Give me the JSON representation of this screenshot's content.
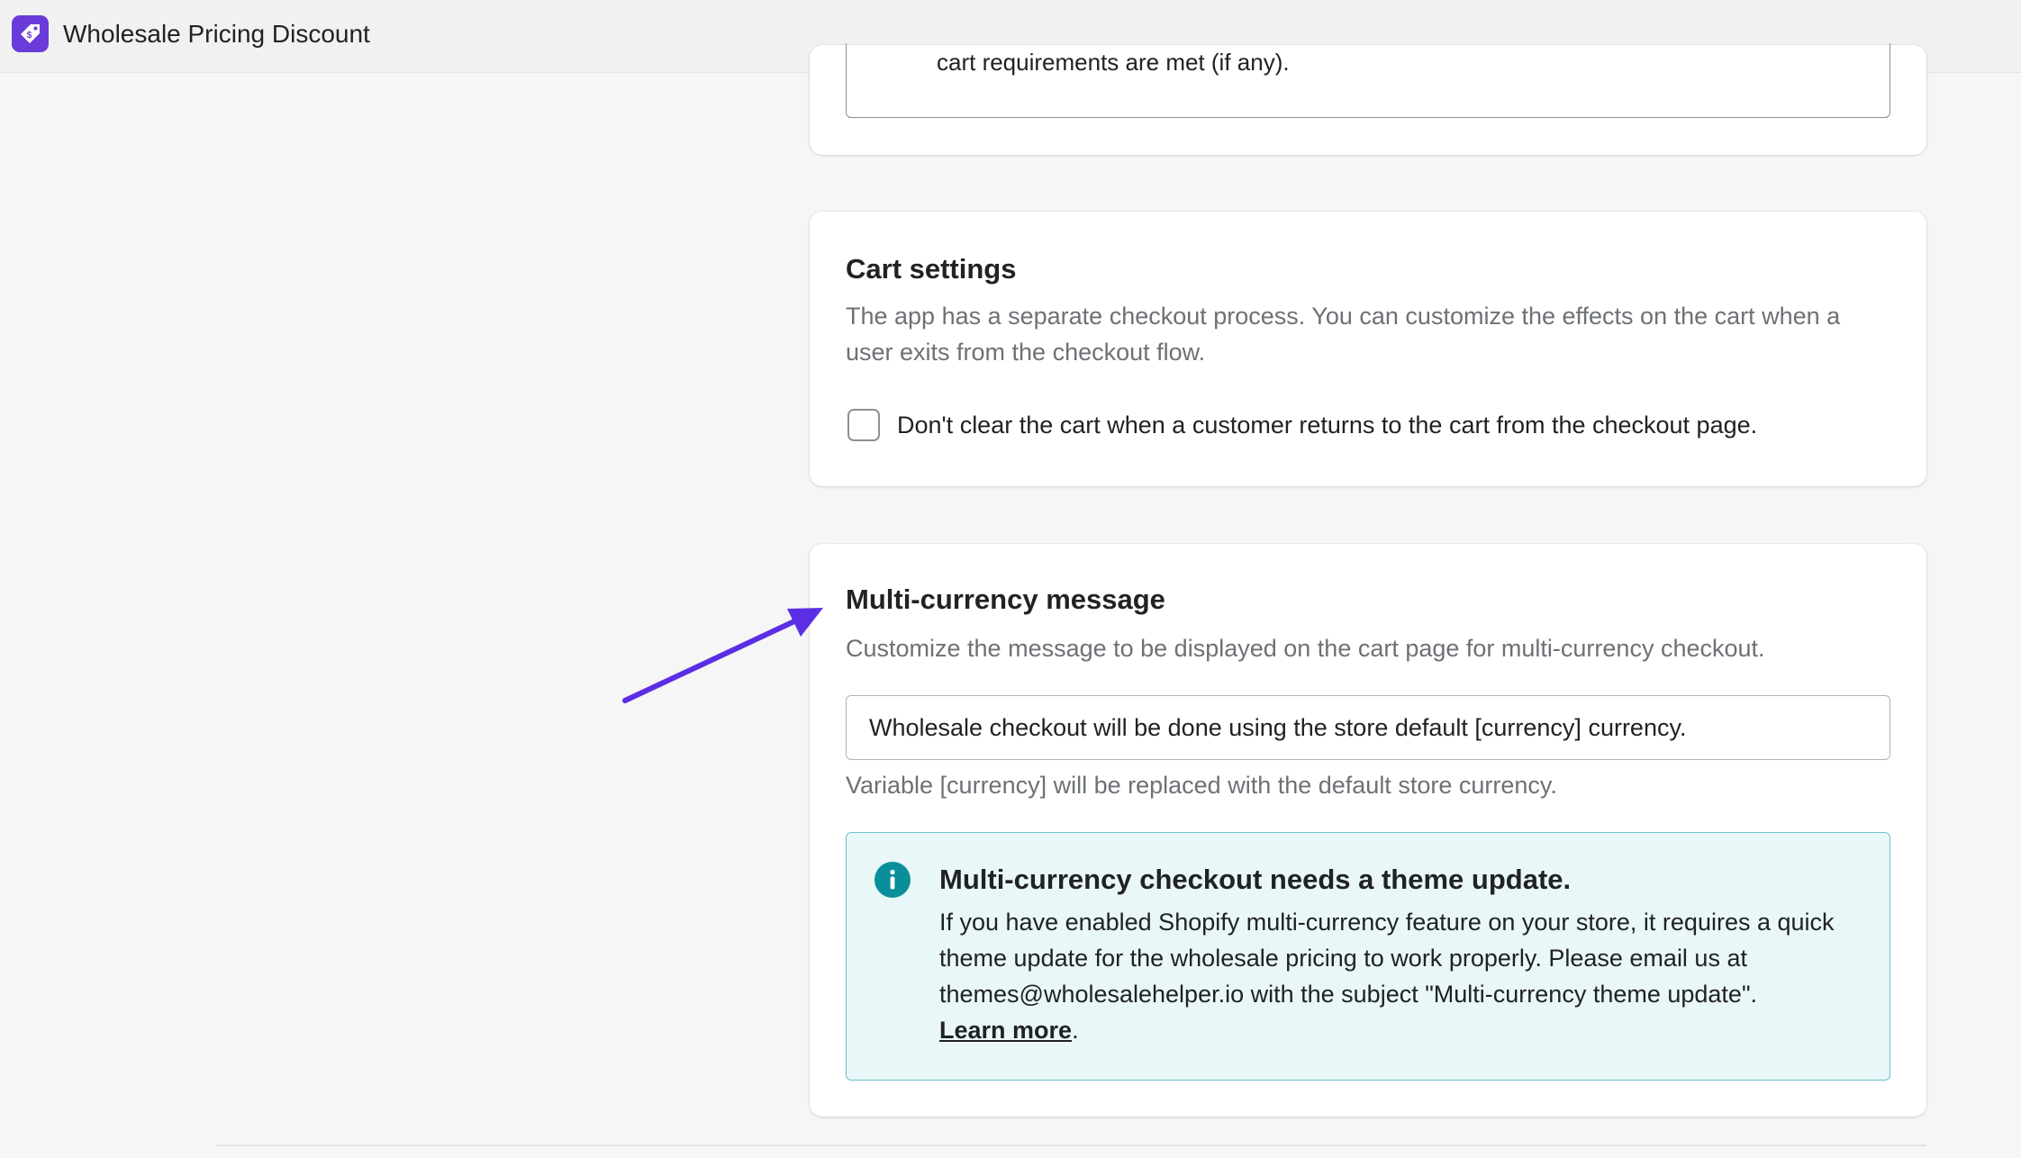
{
  "app": {
    "title": "Wholesale Pricing Discount",
    "icon": "price-tag-icon",
    "accent_color": "#6a3bd8"
  },
  "previous_card": {
    "partial_text": "cart requirements are met (if any)."
  },
  "cart_settings": {
    "title": "Cart settings",
    "description": "The app has a separate checkout process. You can customize the effects on the cart when a user exits from the checkout flow.",
    "checkbox_label": "Don't clear the cart when a customer returns to the cart from the checkout page.",
    "checkbox_checked": false
  },
  "multi_currency": {
    "title": "Multi-currency message",
    "description": "Customize the message to be displayed on the cart page for multi-currency checkout.",
    "input_value": "Wholesale checkout will be done using the store default [currency] currency.",
    "help_text": "Variable [currency] will be replaced with the default store currency.",
    "banner": {
      "icon": "info-icon",
      "title": "Multi-currency checkout needs a theme update.",
      "body": "If you have enabled Shopify multi-currency feature on your store, it requires a quick theme update for the wholesale pricing to work properly. Please email us at themes@wholesalehelper.io with the subject \"Multi-currency theme update\".",
      "link_label": "Learn more",
      "trailing": ".",
      "color": "#0a8f9a"
    }
  },
  "annotation": {
    "icon": "arrow-icon",
    "color": "#5b2ee6"
  }
}
